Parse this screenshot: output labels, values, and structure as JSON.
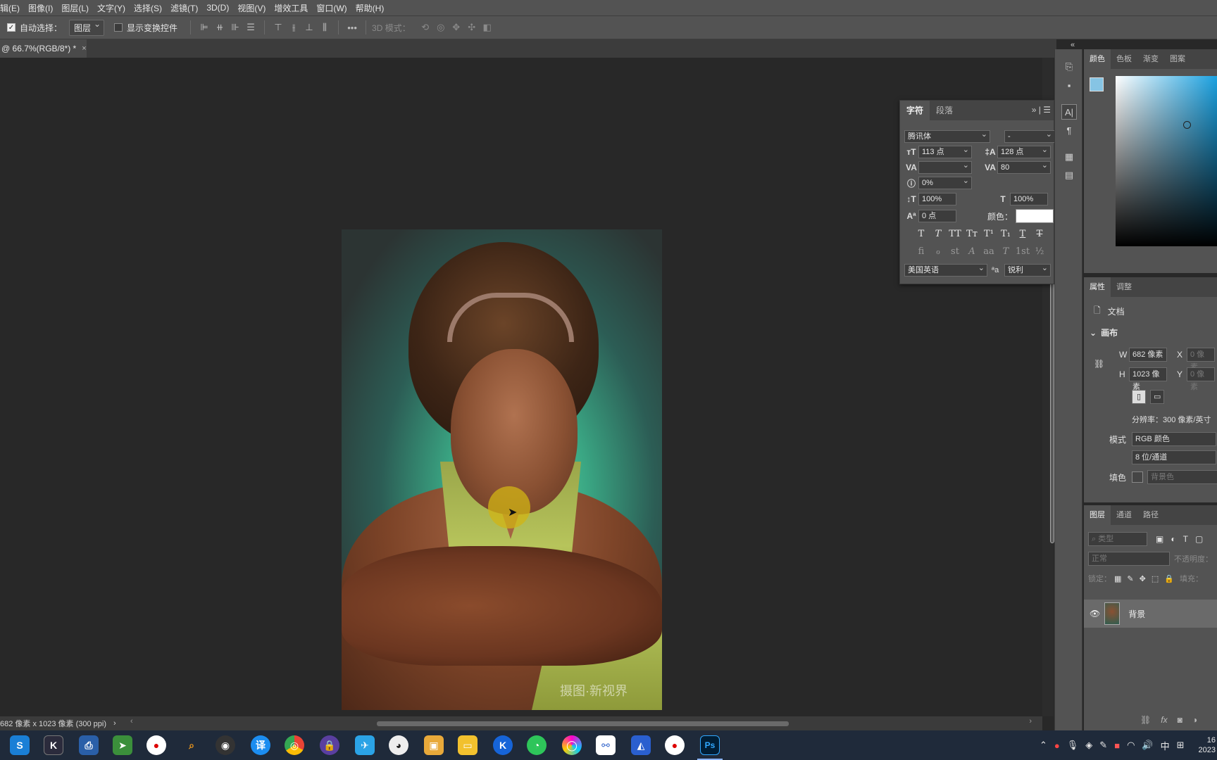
{
  "menu": [
    "辑(E)",
    "图像(I)",
    "图层(L)",
    "文字(Y)",
    "选择(S)",
    "滤镜(T)",
    "3D(D)",
    "视图(V)",
    "增效工具",
    "窗口(W)",
    "帮助(H)"
  ],
  "options": {
    "auto_select_label": "自动选择：",
    "auto_select_value": "图层",
    "transform_label": "显示变换控件",
    "more": "•••",
    "mode_3d": "3D 模式："
  },
  "document": {
    "tab_title": "@ 66.7%(RGB/8*) *",
    "close": "×",
    "watermark": "摄图·新视界",
    "status": "682 像素 x 1023 像素 (300 ppi)",
    "status_arrow": "›"
  },
  "character_panel": {
    "tabs": [
      "字符",
      "段落"
    ],
    "font_family": "腾讯体",
    "font_style": "-",
    "font_size": "113 点",
    "leading": "128 点",
    "kerning": "",
    "tracking": "80",
    "tsume": "0%",
    "vscale": "100%",
    "hscale": "100%",
    "baseline": "0 点",
    "color_label": "颜色：",
    "style_buttons": [
      "T",
      "T",
      "TT",
      "Tт",
      "T¹",
      "T₁",
      "T",
      "T"
    ],
    "ot_buttons": [
      "fi",
      "ℴ",
      "st",
      "A",
      "aa",
      "T",
      "1st",
      "½"
    ],
    "language": "美国英语",
    "aa_label": "ªa",
    "antialias": "锐利"
  },
  "color_panel": {
    "tabs": [
      "颜色",
      "色板",
      "渐变",
      "图案"
    ],
    "fg_color": "#86c4e4",
    "hue_color": "#1ba1e0"
  },
  "properties_panel": {
    "tabs": [
      "属性",
      "调整"
    ],
    "doc_label": "文档",
    "canvas_label": "画布",
    "w_label": "W",
    "w_value": "682 像素",
    "h_label": "H",
    "h_value": "1023 像素",
    "x_label": "X",
    "x_value": "0 像素",
    "y_label": "Y",
    "y_value": "0 像素",
    "resolution": "分辨率：300 像素/英寸",
    "mode_label": "模式",
    "mode_value": "RGB 颜色",
    "depth_value": "8 位/通道",
    "fill_label": "填色",
    "fill_value": "背景色"
  },
  "layers_panel": {
    "tabs": [
      "图层",
      "通道",
      "路径"
    ],
    "filter_placeholder": "类型",
    "blend_mode": "正常",
    "opacity_label": "不透明度：",
    "lock_label": "锁定：",
    "fill_label": "填充：",
    "layer_name": "背景"
  },
  "taskbar": {
    "tray_lang": "中",
    "clock_time": "16",
    "clock_date": "2023"
  }
}
